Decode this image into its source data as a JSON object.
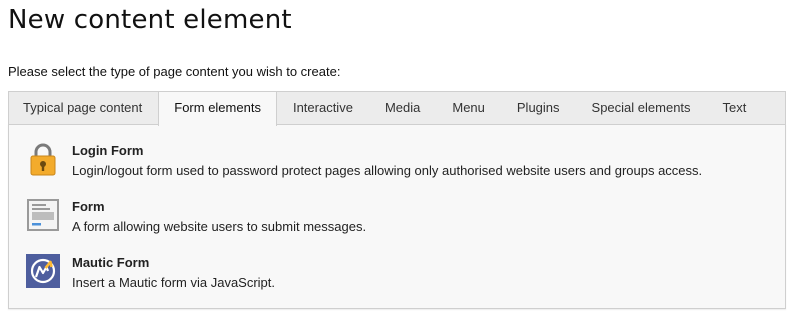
{
  "page": {
    "title": "New content element",
    "instruction": "Please select the type of page content you wish to create:"
  },
  "tabs": [
    {
      "label": "Typical page content",
      "active": false
    },
    {
      "label": "Form elements",
      "active": true
    },
    {
      "label": "Interactive",
      "active": false
    },
    {
      "label": "Media",
      "active": false
    },
    {
      "label": "Menu",
      "active": false
    },
    {
      "label": "Plugins",
      "active": false
    },
    {
      "label": "Special elements",
      "active": false
    },
    {
      "label": "Text",
      "active": false
    }
  ],
  "items": [
    {
      "title": "Login Form",
      "description": "Login/logout form used to password protect pages allowing only authorised website users and groups access.",
      "icon": "lock-icon"
    },
    {
      "title": "Form",
      "description": "A form allowing website users to submit messages.",
      "icon": "form-icon"
    },
    {
      "title": "Mautic Form",
      "description": "Insert a Mautic form via JavaScript.",
      "icon": "mautic-icon"
    }
  ],
  "colors": {
    "lock_body": "#f3ab2c",
    "mautic_bg": "#4e5e9e",
    "mautic_accent": "#fdb933"
  }
}
